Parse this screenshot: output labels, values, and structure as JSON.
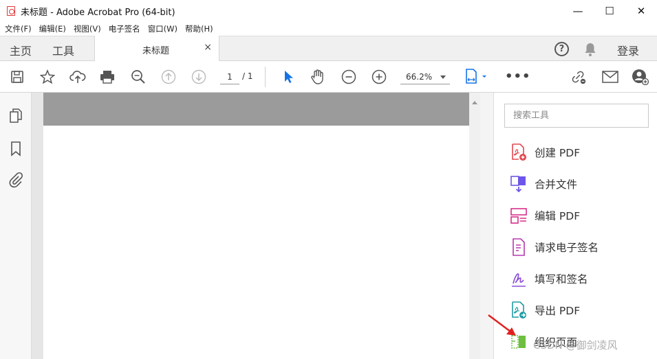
{
  "window": {
    "title": "未标题 - Adobe Acrobat Pro (64-bit)",
    "minimize_label": "—",
    "maximize_label": "☐",
    "close_label": "✕"
  },
  "menu": {
    "items": [
      {
        "label": "文件(F)"
      },
      {
        "label": "编辑(E)"
      },
      {
        "label": "视图(V)"
      },
      {
        "label": "电子签名"
      },
      {
        "label": "窗口(W)"
      },
      {
        "label": "帮助(H)"
      }
    ]
  },
  "tabs": {
    "home_label": "主页",
    "tools_label": "工具",
    "document_tab_title": "未标题",
    "document_tab_close": "×",
    "help_label": "?",
    "login_label": "登录"
  },
  "toolbar": {
    "page_current": "1",
    "page_total": "/ 1",
    "zoom_value": "66.2%",
    "more_label": "•••",
    "accent_color": "#1473e6"
  },
  "tools_pane": {
    "search_placeholder": "搜索工具",
    "items": [
      {
        "label": "创建 PDF",
        "icon": "create-pdf-icon",
        "color": "#e34850"
      },
      {
        "label": "合并文件",
        "icon": "combine-files-icon",
        "color": "#6e56e8"
      },
      {
        "label": "编辑 PDF",
        "icon": "edit-pdf-icon",
        "color": "#d92d8a"
      },
      {
        "label": "请求电子签名",
        "icon": "request-signature-icon",
        "color": "#b538b0"
      },
      {
        "label": "填写和签名",
        "icon": "fill-sign-icon",
        "color": "#8a4fd6"
      },
      {
        "label": "导出 PDF",
        "icon": "export-pdf-icon",
        "color": "#1e9aa5"
      },
      {
        "label": "组织页面",
        "icon": "organize-pages-icon",
        "color": "#6dbf3f"
      }
    ]
  },
  "watermark": "CSDN @御剑凌风"
}
